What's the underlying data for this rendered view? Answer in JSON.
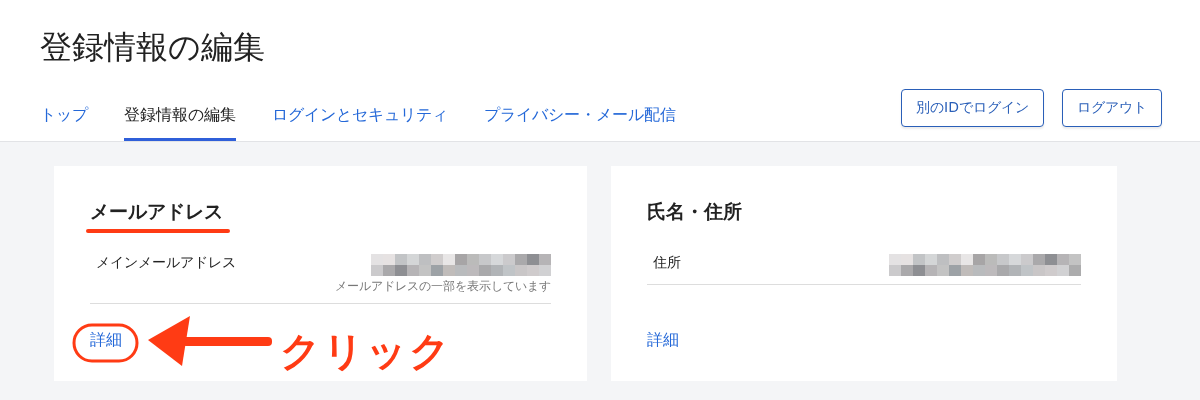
{
  "page_title": "登録情報の編集",
  "tabs": [
    {
      "label": "トップ",
      "selected": false
    },
    {
      "label": "登録情報の編集",
      "selected": true
    },
    {
      "label": "ログインとセキュリティ",
      "selected": false
    },
    {
      "label": "プライバシー・メール配信",
      "selected": false
    }
  ],
  "header_buttons": [
    "別のIDでログイン",
    "ログアウト"
  ],
  "cards": [
    {
      "title": "メールアドレス",
      "rows": [
        {
          "label": "メインメールアドレス",
          "note": "メールアドレスの一部を表示しています"
        }
      ],
      "link": "詳細",
      "annotation": {
        "text": "クリック"
      }
    },
    {
      "title": "氏名・住所",
      "rows": [
        {
          "label": "住所"
        }
      ],
      "link": "詳細"
    }
  ]
}
